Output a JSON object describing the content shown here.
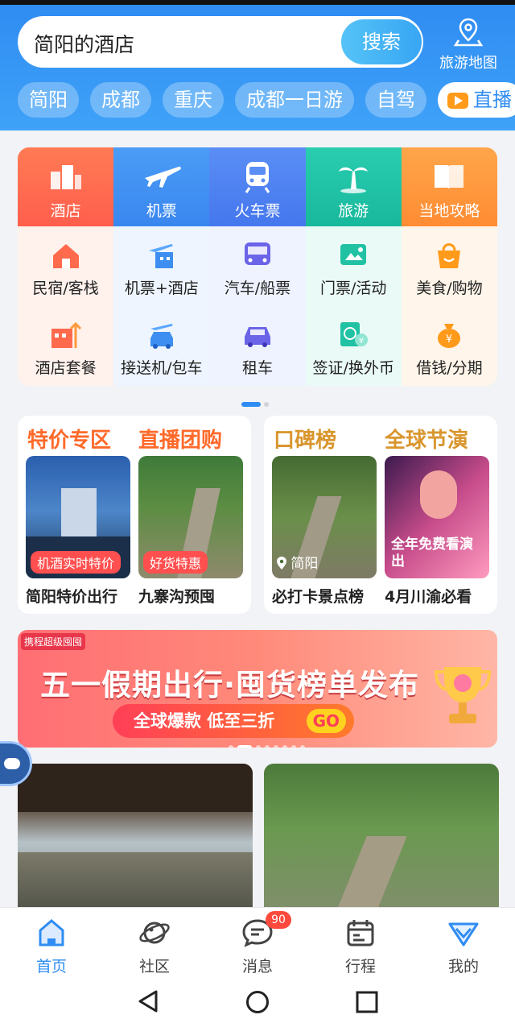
{
  "search": {
    "query": "简阳的酒店",
    "button": "搜索"
  },
  "map_button": {
    "label": "旅游地图"
  },
  "chips": [
    "简阳",
    "成都",
    "重庆",
    "成都一日游",
    "自驾",
    "直播"
  ],
  "grid": {
    "columns": [
      {
        "top": {
          "label": "酒店",
          "icon": "hotel-icon",
          "color": "#ff6a4d"
        },
        "items": [
          {
            "label": "民宿/客栈",
            "icon": "homestay-icon"
          },
          {
            "label": "酒店套餐",
            "icon": "hotel-package-icon"
          }
        ]
      },
      {
        "top": {
          "label": "机票",
          "icon": "plane-icon",
          "color": "#3d8ef0"
        },
        "items": [
          {
            "label": "机票+酒店",
            "icon": "flight-hotel-icon"
          },
          {
            "label": "接送机/包车",
            "icon": "airport-transfer-icon"
          }
        ]
      },
      {
        "top": {
          "label": "火车票",
          "icon": "train-icon",
          "color": "#4d7ff2"
        },
        "items": [
          {
            "label": "汽车/船票",
            "icon": "bus-icon"
          },
          {
            "label": "租车",
            "icon": "car-rental-icon"
          }
        ]
      },
      {
        "top": {
          "label": "旅游",
          "icon": "palm-tree-icon",
          "color": "#21c2a4"
        },
        "items": [
          {
            "label": "门票/活动",
            "icon": "ticket-icon"
          },
          {
            "label": "签证/换外币",
            "icon": "visa-icon"
          }
        ]
      },
      {
        "top": {
          "label": "当地攻略",
          "icon": "guide-book-icon",
          "color": "#ff9a3d"
        },
        "items": [
          {
            "label": "美食/购物",
            "icon": "shopping-bag-icon"
          },
          {
            "label": "借钱/分期",
            "icon": "money-bag-icon"
          }
        ]
      }
    ]
  },
  "promo_left": {
    "h1": "特价专区",
    "h2": "直播团购",
    "t1_tag": "机酒实时特价",
    "t2_tag": "好货特惠",
    "c1": "简阳特价出行",
    "c2": "九寨沟预囤"
  },
  "promo_right": {
    "h1": "口碑榜",
    "h2": "全球节演",
    "t1_loc": "简阳",
    "t2_text": "全年免费看演出",
    "c1": "必打卡景点榜",
    "c2": "4月川渝必看"
  },
  "banner": {
    "logo": "携程超级囤囤",
    "title": "五一假期出行·囤货榜单发布",
    "sub": "全球爆款 低至三折",
    "go": "GO"
  },
  "tabbar": [
    {
      "label": "首页",
      "icon": "home-icon",
      "active": true
    },
    {
      "label": "社区",
      "icon": "planet-icon"
    },
    {
      "label": "消息",
      "icon": "message-icon",
      "badge": "90"
    },
    {
      "label": "行程",
      "icon": "calendar-icon"
    },
    {
      "label": "我的",
      "icon": "profile-icon"
    }
  ],
  "colors": {
    "brand": "#2f8cf2",
    "orange": "#ff6a2a",
    "gold": "#d9962e"
  }
}
